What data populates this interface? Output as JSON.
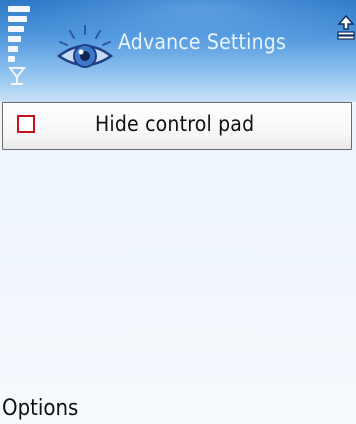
{
  "status": {
    "signal_icon": "signal-strength-icon",
    "signal_indicator": "antenna-icon",
    "right_indicator": "upload-arrow-icon"
  },
  "header": {
    "app_icon": "eye-icon",
    "title": "Advance Settings"
  },
  "settings": {
    "items": [
      {
        "label": "Hide control pad",
        "checked": false
      }
    ]
  },
  "softkeys": {
    "left": "Options"
  },
  "colors": {
    "title_bar": "#4f97dd",
    "background": "#eef5fc",
    "checkbox_border": "#c8111a"
  }
}
